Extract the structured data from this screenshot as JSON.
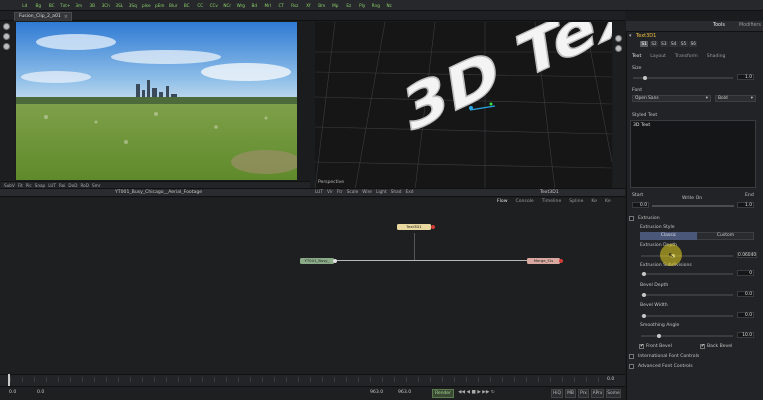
{
  "toolbar": {
    "items": [
      "Ld",
      "Bg",
      "BC",
      "Txt+",
      "3m",
      "3B",
      "3Ch",
      "3SL",
      "3Sq",
      "plse",
      "pEm",
      "Blur",
      "BC",
      "CC",
      "CCv",
      "NCr",
      "Wrg",
      "Bd",
      "Mrl",
      "CT",
      "Rsz",
      "Xf",
      "Bm",
      "Mp",
      "Ez",
      "Ply",
      "Rng",
      "Nc"
    ]
  },
  "tab": {
    "label": "Fusion_Clip_2_a01",
    "close": "×"
  },
  "viewer_left": {
    "toolbar": [
      "SubV",
      "Fit",
      "Pic",
      "Snap",
      "LUT",
      "Roi",
      "DoD",
      "RoD",
      "Smr"
    ],
    "clip_name": "YT001_Busy_Chicago__Aerial_Footage"
  },
  "viewer_right": {
    "text3d": "3D Text",
    "label": "Perspective",
    "toolbar": [
      "LUT",
      "Vir",
      "Ftr",
      "Scale",
      "Wire",
      "Light",
      "Shad",
      "Exd"
    ],
    "name": "Text3D1"
  },
  "flow": {
    "tabs": [
      "Flow",
      "Console",
      "Timeline",
      "Spline",
      "Ke",
      "Ke"
    ],
    "nodes": {
      "text3d": "Text3D1",
      "media": "YT001_Busy_",
      "merge": "Merge_f1s"
    }
  },
  "timeline": {
    "start": "0.0",
    "end": "0.0"
  },
  "transport": {
    "left_a": "0.0",
    "left_b": "0.0",
    "current": "963.0",
    "end": "963.0",
    "render": "Render",
    "hiq": "HiQ",
    "mb": "MB",
    "prx": "Prx",
    "aprx": "APrx",
    "some": "Some"
  },
  "inspector": {
    "tabs": {
      "tools": "Tools",
      "modifiers": "Modifiers"
    },
    "node_title": "Text3D1",
    "presets": [
      "S1",
      "S2",
      "S3",
      "S4",
      "S5",
      "S6"
    ],
    "subtabs": [
      "Text",
      "Layout",
      "Transform",
      "Shading"
    ],
    "size": {
      "label": "Size",
      "value": "1.0",
      "level": 0.1
    },
    "font": {
      "label": "Font",
      "value": "Open Sans",
      "style": "Bold"
    },
    "styled_text": {
      "label": "Styled Text",
      "value": "3D Text"
    },
    "write_on": {
      "start_label": "Start",
      "label": "Write On",
      "end_label": "End",
      "start": "0.0",
      "end": "1.0"
    },
    "extrusion": {
      "label": "Extrusion",
      "style_label": "Extrusion Style",
      "style_options": [
        "Classic",
        "Custom"
      ],
      "depth_label": "Extrusion Depth",
      "depth_value": "0.06040",
      "subdiv_label": "Extrusion Subdivisions",
      "subdiv_value": "0",
      "bevel_depth_label": "Bevel Depth",
      "bevel_depth_value": "0.0",
      "bevel_width_label": "Bevel Width",
      "bevel_width_value": "0.0",
      "smooth_label": "Smoothing Angle",
      "smooth_value": "10.0",
      "front_bevel": "Front Bevel",
      "back_bevel": "Back Bevel",
      "intl_font": "International Font Controls",
      "adv_font": "Advanced Font Controls"
    }
  },
  "colors": {
    "node_text": "#f0c040",
    "accent": "#4b5778"
  }
}
